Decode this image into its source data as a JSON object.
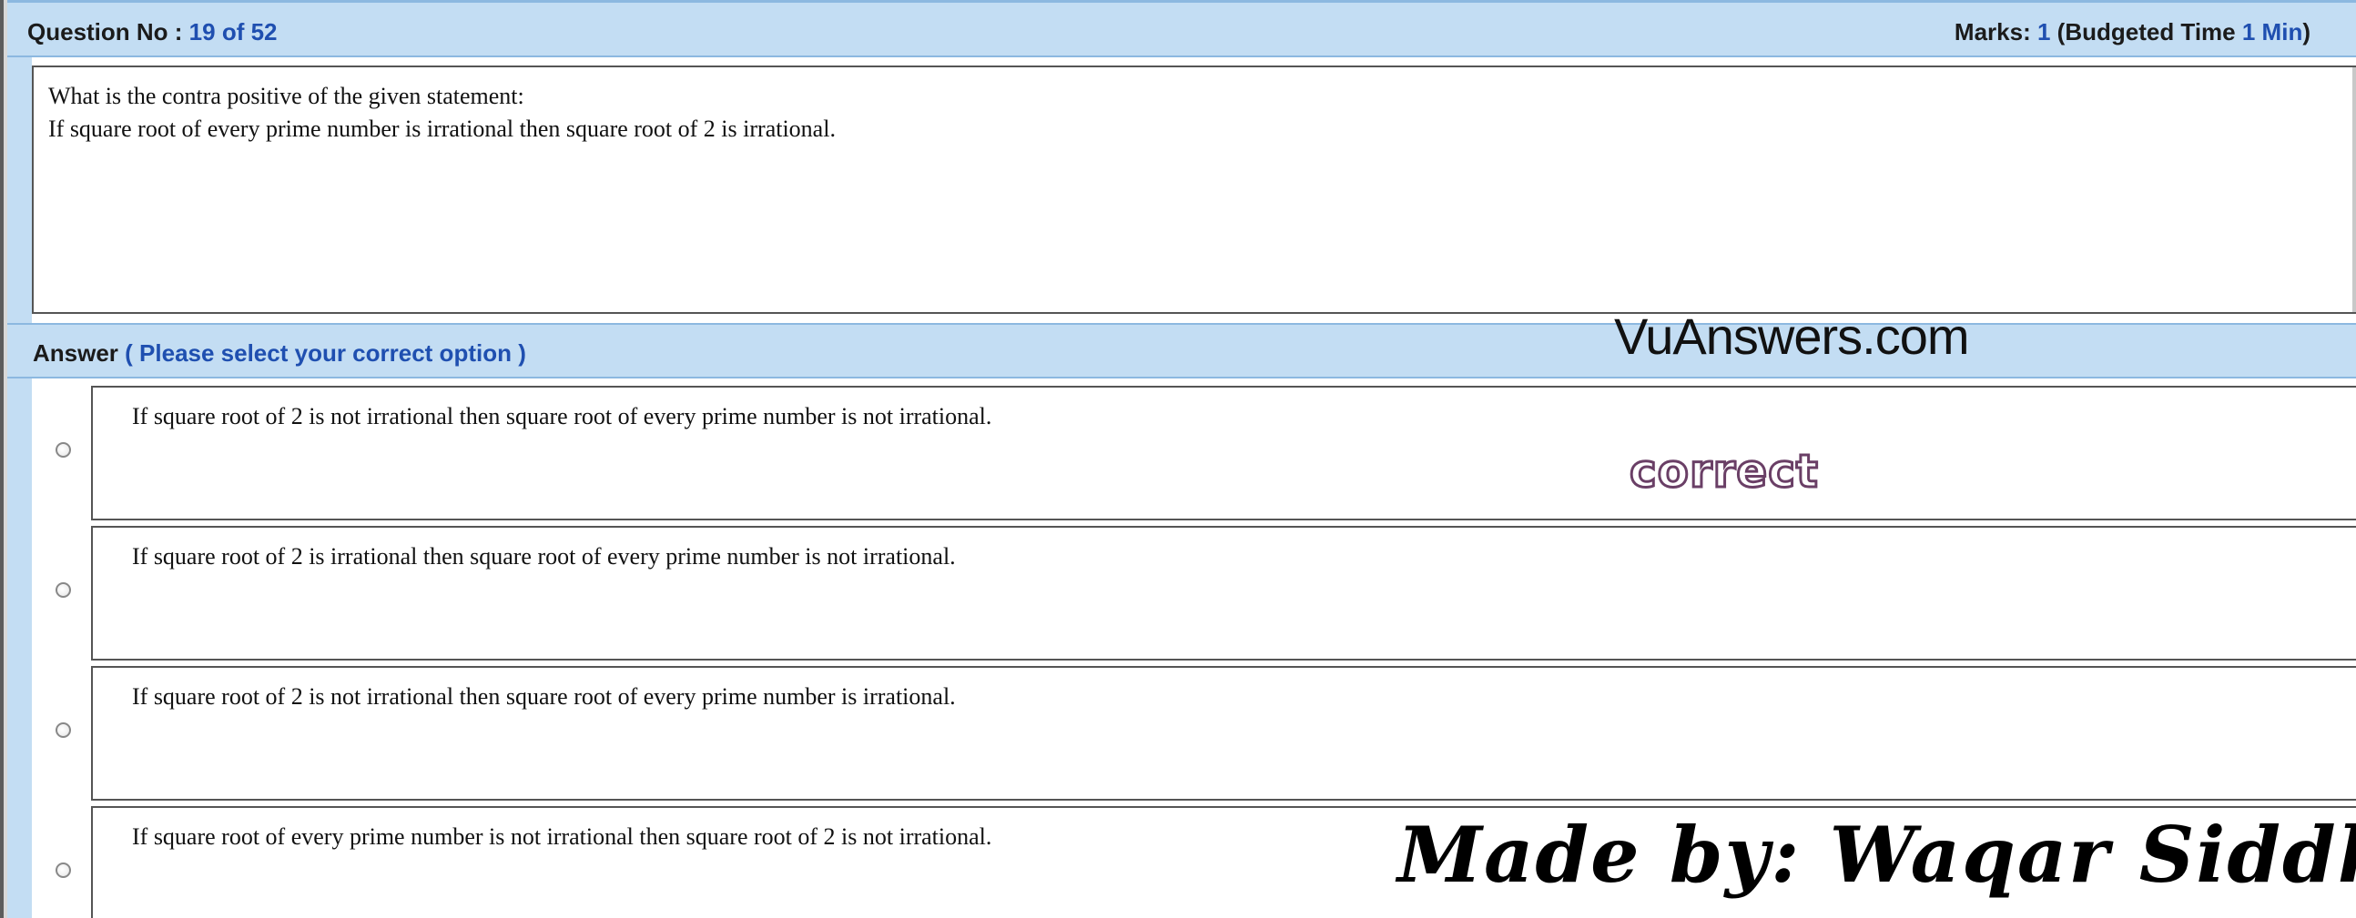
{
  "header": {
    "question_label": "Question No : ",
    "question_number": "19 of 52",
    "marks_label": "Marks: ",
    "marks_value": "1",
    "budget_label": " (Budgeted Time ",
    "budget_value": "1 Min",
    "budget_close": ")"
  },
  "question": {
    "lines": [
      "What is the contra positive of the given statement:",
      "If square root of every prime number is irrational then square root of 2 is irrational."
    ]
  },
  "answer": {
    "label": "Answer ",
    "instruction": "( Please select your correct option )"
  },
  "options": [
    "If square root of 2 is not irrational then square root of every prime number is not irrational.",
    "If square root of 2 is irrational then square root of every prime number is not irrational.",
    "If square root of 2 is not irrational then square root of every prime number is irrational.",
    "If square root of every prime number is not irrational then square root of 2 is not irrational."
  ],
  "overlays": {
    "site_watermark": "VuAnswers.com",
    "correct_mark": "correct",
    "signature": "Made by: Waqar Siddhu"
  },
  "colors": {
    "header_bg": "#c3ddf3",
    "accent_blue": "#1f4fb0",
    "border": "#555555"
  }
}
